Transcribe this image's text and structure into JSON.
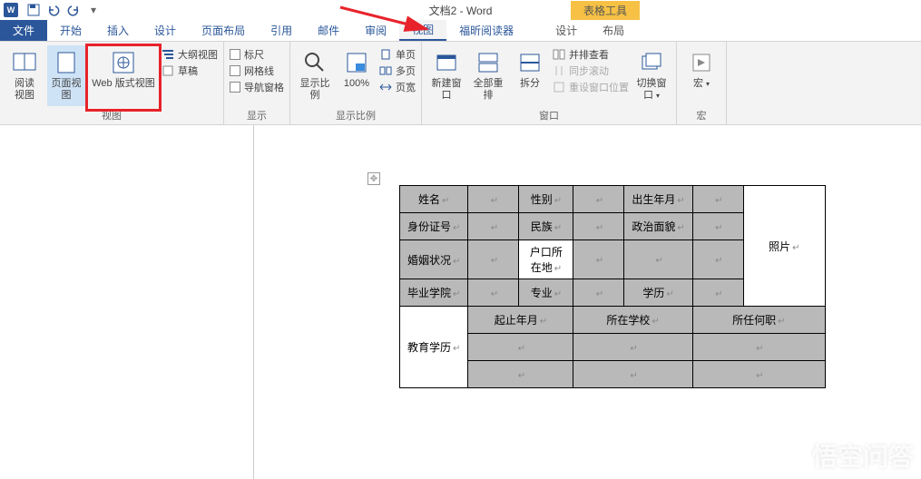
{
  "titlebar": {
    "title": "文档2 - Word",
    "context_tab": "表格工具"
  },
  "tabs": {
    "file": "文件",
    "home": "开始",
    "insert": "插入",
    "design": "设计",
    "layout": "页面布局",
    "refs": "引用",
    "mail": "邮件",
    "review": "审阅",
    "view": "视图",
    "foxit": "福昕阅读器",
    "tbl_design": "设计",
    "tbl_layout": "布局"
  },
  "ribbon": {
    "views": {
      "read": "阅读\n视图",
      "print": "页面视图",
      "web": "Web 版式视图",
      "outline": "大纲视图",
      "draft": "草稿",
      "group": "视图"
    },
    "show": {
      "ruler": "标尺",
      "gridlines": "网格线",
      "navpane": "导航窗格",
      "group": "显示"
    },
    "zoom": {
      "zoom": "显示比例",
      "hundred": "100%",
      "onepage": "单页",
      "multipage": "多页",
      "pagewidth": "页宽",
      "group": "显示比例"
    },
    "window": {
      "newwin": "新建窗口",
      "arrange": "全部重排",
      "split": "拆分",
      "sidebyside": "并排查看",
      "syncscroll": "同步滚动",
      "resetpos": "重设窗口位置",
      "switch": "切换窗口",
      "group": "窗口"
    },
    "macros": {
      "macros": "宏",
      "group": "宏"
    }
  },
  "table": {
    "r1": {
      "name": "姓名",
      "gender": "性别",
      "birth": "出生年月"
    },
    "r2": {
      "id": "身份证号",
      "ethnic": "民族",
      "politics": "政治面貌"
    },
    "r3": {
      "marital": "婚姻状况",
      "hukou": "户口所\n在地"
    },
    "r4": {
      "school": "毕业学院",
      "major": "专业",
      "degree": "学历"
    },
    "photo": "照片",
    "r5": {
      "period": "起止年月",
      "atschool": "所在学校",
      "position": "所任何职"
    },
    "edu": "教育学历"
  },
  "watermark": "悟空问答"
}
